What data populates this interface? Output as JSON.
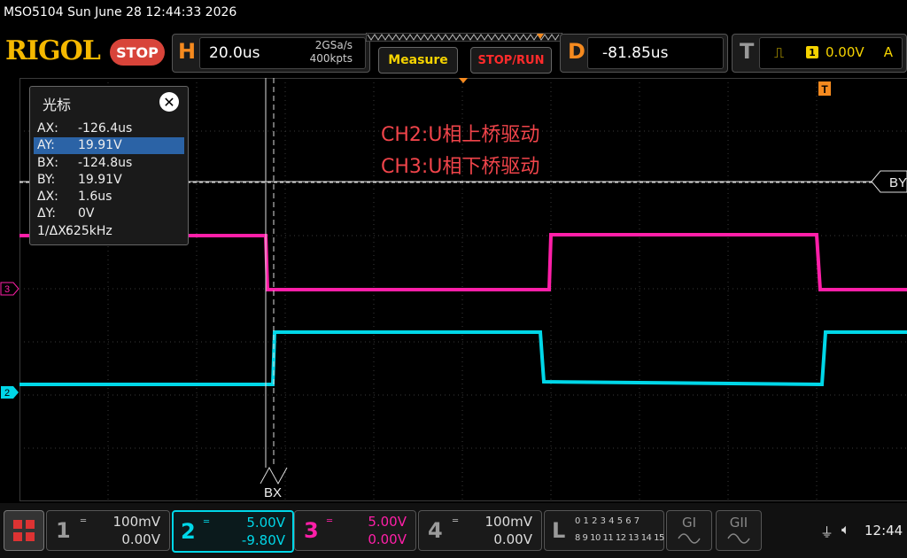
{
  "status": {
    "title": "MSO5104  Sun June 28 12:44:33 2026"
  },
  "brand": {
    "logo": "RIGOL"
  },
  "run_state": "STOP",
  "horizontal": {
    "letter": "H",
    "timebase": "20.0us",
    "sample_rate": "2GSa/s",
    "memory_depth": "400kpts"
  },
  "measure_label": "Measure",
  "stoprun_label": "STOP/RUN",
  "delay": {
    "letter": "D",
    "value": "-81.85us"
  },
  "trigger": {
    "letter": "T",
    "source": "1",
    "level": "0.00V",
    "mode": "A"
  },
  "cursor_panel": {
    "title": "光标",
    "rows": [
      {
        "key": "AX:",
        "value": "-126.4us"
      },
      {
        "key": "AY:",
        "value": "19.91V"
      },
      {
        "key": "BX:",
        "value": "-124.8us"
      },
      {
        "key": "BY:",
        "value": "19.91V"
      },
      {
        "key": "ΔX:",
        "value": "1.6us"
      },
      {
        "key": "ΔY:",
        "value": "0V"
      },
      {
        "key": "1/ΔX:",
        "value": "625kHz"
      }
    ],
    "selected_row": 1
  },
  "annotations": [
    "CH2:U相上桥驱动",
    "CH3:U相下桥驱动"
  ],
  "cursor_labels": {
    "by": "BY",
    "bx": "BX"
  },
  "channel_markers": {
    "ch3": "3",
    "ch2": "2"
  },
  "channels": [
    {
      "num": "1",
      "scale": "100mV",
      "offset": "0.00V",
      "color": "#9a9a9a"
    },
    {
      "num": "2",
      "scale": "5.00V",
      "offset": "-9.80V",
      "color": "#00d7e8"
    },
    {
      "num": "3",
      "scale": "5.00V",
      "offset": "0.00V",
      "color": "#ff1fa8"
    },
    {
      "num": "4",
      "scale": "100mV",
      "offset": "0.00V",
      "color": "#9a9a9a"
    }
  ],
  "la": {
    "letter": "L",
    "row1": "0 1 2 3  4 5 6 7",
    "row2": "8 9 10 11 12 13 14 15"
  },
  "gen1": "GI",
  "gen2": "GII",
  "clock": "12:44",
  "colors": {
    "ch2": "#00d7e8",
    "ch3": "#ff1fa8",
    "accent": "#f58a1f",
    "trigger": "#f5d300"
  }
}
